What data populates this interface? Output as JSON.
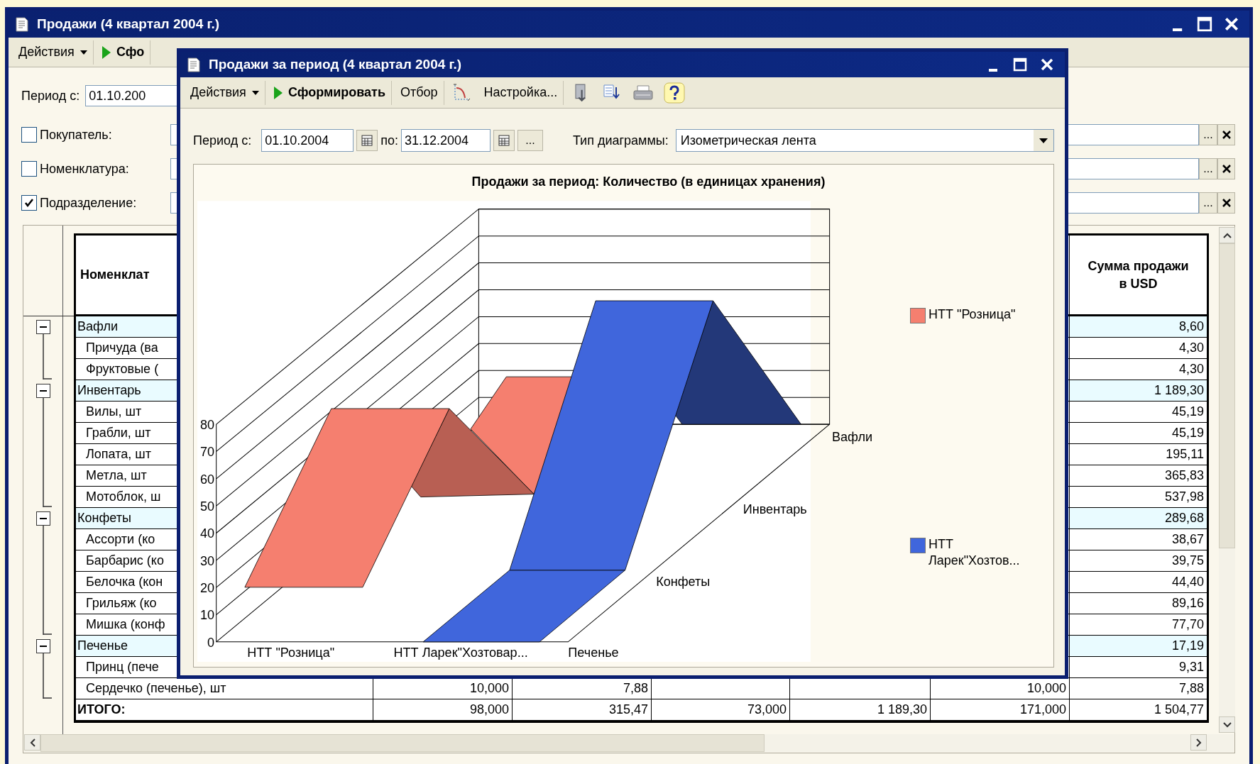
{
  "window": {
    "title": "Продажи (4 квартал 2004 г.)",
    "toolbar": [
      {
        "kind": "menu",
        "label": "Действия"
      },
      {
        "kind": "run",
        "label": "Сфо"
      }
    ],
    "period_label": "Период с:",
    "period_from": "01.10.200",
    "filters": [
      {
        "label": "Покупатель:",
        "checked": false,
        "select": "..."
      },
      {
        "label": "Номенклатура:",
        "checked": false,
        "select": "..."
      },
      {
        "label": "Подразделение:",
        "checked": true,
        "select": "..."
      }
    ]
  },
  "report": {
    "header": {
      "name": "Номенклат",
      "usd": "Сумма продажи в USD"
    },
    "rows": [
      {
        "name": "Вафли",
        "expanded": true,
        "usd": "8,60",
        "children": [
          {
            "name": "Причуда (ва",
            "usd": "4,30"
          },
          {
            "name": "Фруктовые (",
            "usd": "4,30"
          }
        ]
      },
      {
        "name": "Инвентарь",
        "expanded": true,
        "usd": "1 189,30",
        "children": [
          {
            "name": "Вилы, шт",
            "usd": "45,19"
          },
          {
            "name": "Грабли, шт",
            "usd": "45,19"
          },
          {
            "name": "Лопата, шт",
            "usd": "195,11"
          },
          {
            "name": "Метла, шт",
            "usd": "365,83"
          },
          {
            "name": "Мотоблок, ш",
            "usd": "537,98"
          }
        ]
      },
      {
        "name": "Конфеты",
        "expanded": true,
        "usd": "289,68",
        "children": [
          {
            "name": "Ассорти (ко",
            "usd": "38,67"
          },
          {
            "name": "Барбарис (ко",
            "usd": "39,75"
          },
          {
            "name": "Белочка (кон",
            "usd": "44,40"
          },
          {
            "name": "Грильяж (ко",
            "usd": "89,16"
          },
          {
            "name": "Мишка (конф",
            "usd": "77,70"
          }
        ]
      },
      {
        "name": "Печенье",
        "expanded": true,
        "usd": "17,19",
        "children": [
          {
            "name": "Принц (пече",
            "usd": "9,31"
          },
          {
            "name": "Сердечко (печенье), шт",
            "cells": [
              "10,000",
              "7,88",
              null,
              null,
              "10,000"
            ],
            "usd": "7,88"
          }
        ]
      }
    ],
    "total": {
      "name": "ИТОГО:",
      "cells": [
        "98,000",
        "315,47",
        "73,000",
        "1 189,30",
        "171,000"
      ],
      "usd": "1 504,77"
    }
  },
  "dialog": {
    "title": "Продажи за период (4 квартал 2004 г.)",
    "toolbar": [
      {
        "kind": "menu",
        "label": "Действия"
      },
      {
        "kind": "run",
        "label": "Сформировать"
      },
      {
        "kind": "button",
        "label": "Отбор"
      },
      {
        "kind": "icon"
      },
      {
        "kind": "button",
        "label": "Настройка..."
      },
      {
        "kind": "icon"
      },
      {
        "kind": "icon"
      },
      {
        "kind": "icon"
      },
      {
        "kind": "icon"
      }
    ],
    "period_label": "Период с:",
    "date_from": "01.10.2004",
    "to_label": "по:",
    "date_to": "31.12.2004",
    "more": "...",
    "chart_type_label": "Тип диаграммы:",
    "chart_type": "Изометрическая лента",
    "chart": {
      "title": "Продажи за период: Количество (в единицах хранения)",
      "yticks": [
        "80",
        "70",
        "60",
        "50",
        "40",
        "30",
        "20",
        "10",
        "0"
      ],
      "categories": [
        "НТТ \"Розница\"",
        "НТТ Ларек\"Хозтовар..."
      ],
      "depth_labels": [
        "Печенье",
        "Конфеты",
        "Инвентарь",
        "Вафли"
      ],
      "legend": [
        {
          "label": "НТТ \"Розница\"",
          "color": "#f57f6f"
        },
        {
          "label": "НТТ Ларек\"Хозтов...",
          "color": "#4066dc"
        }
      ]
    }
  }
}
